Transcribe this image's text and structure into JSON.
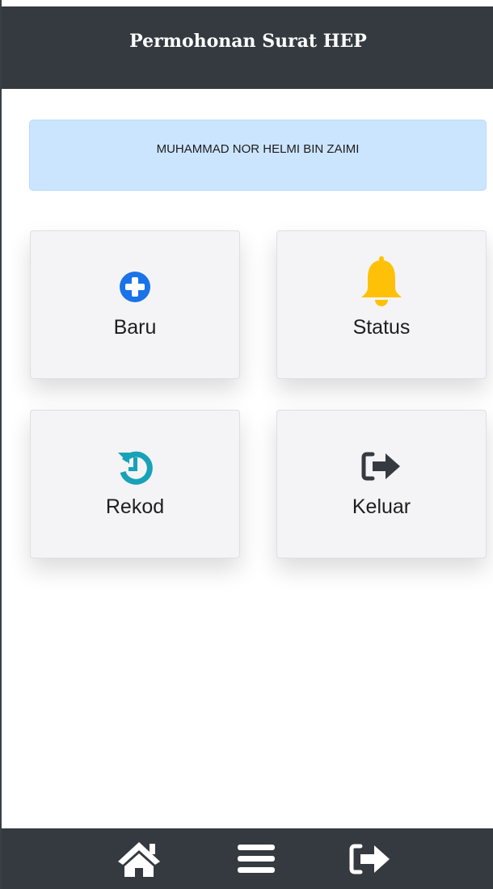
{
  "header": {
    "title": "Permohonan Surat HEP"
  },
  "user": {
    "name": "MUHAMMAD NOR HELMI BIN ZAIMI"
  },
  "menu": [
    {
      "label": "Baru",
      "icon": "plus-circle-icon",
      "color": "#1a73e8"
    },
    {
      "label": "Status",
      "icon": "bell-icon",
      "color": "#ffc107"
    },
    {
      "label": "Rekod",
      "icon": "history-icon",
      "color": "#17a2b8"
    },
    {
      "label": "Keluar",
      "icon": "sign-out-icon",
      "color": "#343a40"
    }
  ],
  "bottom_nav": [
    {
      "icon": "home-icon"
    },
    {
      "icon": "menu-icon"
    },
    {
      "icon": "sign-out-icon"
    }
  ],
  "colors": {
    "bar": "#343a40",
    "alert_bg": "#cce5ff",
    "card_bg": "#f4f4f6"
  }
}
